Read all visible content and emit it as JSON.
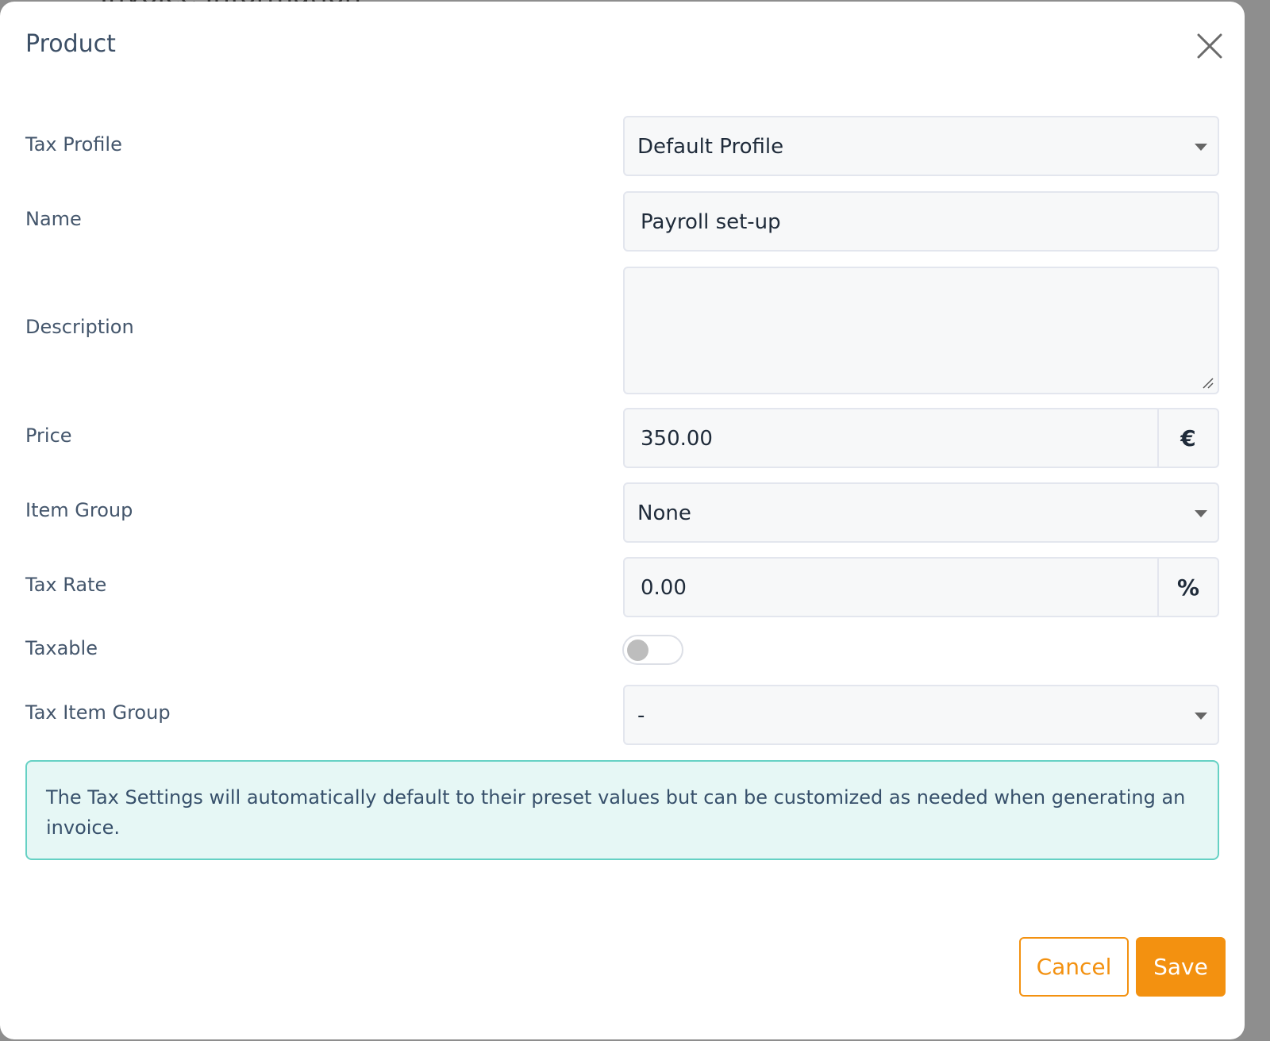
{
  "background": {
    "partial_title": "Invoice Information"
  },
  "modal": {
    "title": "Product",
    "close_icon": "close-icon"
  },
  "form": {
    "tax_profile": {
      "label": "Tax Profile",
      "value": "Default Profile"
    },
    "name": {
      "label": "Name",
      "value": "Payroll set-up"
    },
    "description": {
      "label": "Description",
      "value": ""
    },
    "price": {
      "label": "Price",
      "value": "350.00",
      "addon": "€"
    },
    "item_group": {
      "label": "Item Group",
      "value": "None"
    },
    "tax_rate": {
      "label": "Tax Rate",
      "value": "0.00",
      "addon": "%"
    },
    "taxable": {
      "label": "Taxable",
      "on": false
    },
    "tax_item_group": {
      "label": "Tax Item Group",
      "value": "-"
    }
  },
  "notice": {
    "text": "The Tax Settings will automatically default to their preset values but can be customized as needed when generating an invoice."
  },
  "footer": {
    "cancel_label": "Cancel",
    "save_label": "Save"
  },
  "colors": {
    "accent": "#f39110",
    "notice_border": "#66d1c4",
    "notice_bg": "#e6f7f5"
  }
}
